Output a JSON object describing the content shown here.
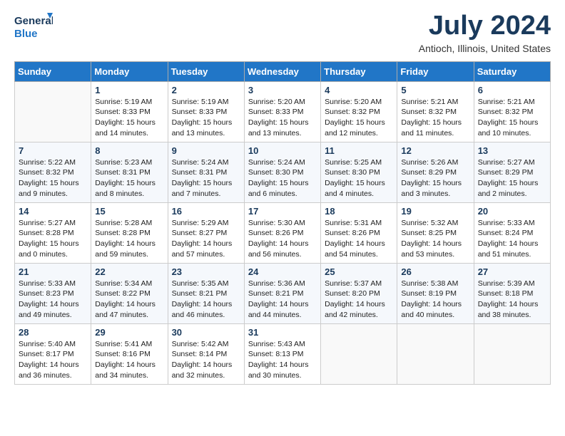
{
  "logo": {
    "line1": "General",
    "line2": "Blue"
  },
  "title": "July 2024",
  "location": "Antioch, Illinois, United States",
  "weekdays": [
    "Sunday",
    "Monday",
    "Tuesday",
    "Wednesday",
    "Thursday",
    "Friday",
    "Saturday"
  ],
  "weeks": [
    [
      {
        "day": "",
        "sunrise": "",
        "sunset": "",
        "daylight": ""
      },
      {
        "day": "1",
        "sunrise": "Sunrise: 5:19 AM",
        "sunset": "Sunset: 8:33 PM",
        "daylight": "Daylight: 15 hours and 14 minutes."
      },
      {
        "day": "2",
        "sunrise": "Sunrise: 5:19 AM",
        "sunset": "Sunset: 8:33 PM",
        "daylight": "Daylight: 15 hours and 13 minutes."
      },
      {
        "day": "3",
        "sunrise": "Sunrise: 5:20 AM",
        "sunset": "Sunset: 8:33 PM",
        "daylight": "Daylight: 15 hours and 13 minutes."
      },
      {
        "day": "4",
        "sunrise": "Sunrise: 5:20 AM",
        "sunset": "Sunset: 8:32 PM",
        "daylight": "Daylight: 15 hours and 12 minutes."
      },
      {
        "day": "5",
        "sunrise": "Sunrise: 5:21 AM",
        "sunset": "Sunset: 8:32 PM",
        "daylight": "Daylight: 15 hours and 11 minutes."
      },
      {
        "day": "6",
        "sunrise": "Sunrise: 5:21 AM",
        "sunset": "Sunset: 8:32 PM",
        "daylight": "Daylight: 15 hours and 10 minutes."
      }
    ],
    [
      {
        "day": "7",
        "sunrise": "Sunrise: 5:22 AM",
        "sunset": "Sunset: 8:32 PM",
        "daylight": "Daylight: 15 hours and 9 minutes."
      },
      {
        "day": "8",
        "sunrise": "Sunrise: 5:23 AM",
        "sunset": "Sunset: 8:31 PM",
        "daylight": "Daylight: 15 hours and 8 minutes."
      },
      {
        "day": "9",
        "sunrise": "Sunrise: 5:24 AM",
        "sunset": "Sunset: 8:31 PM",
        "daylight": "Daylight: 15 hours and 7 minutes."
      },
      {
        "day": "10",
        "sunrise": "Sunrise: 5:24 AM",
        "sunset": "Sunset: 8:30 PM",
        "daylight": "Daylight: 15 hours and 6 minutes."
      },
      {
        "day": "11",
        "sunrise": "Sunrise: 5:25 AM",
        "sunset": "Sunset: 8:30 PM",
        "daylight": "Daylight: 15 hours and 4 minutes."
      },
      {
        "day": "12",
        "sunrise": "Sunrise: 5:26 AM",
        "sunset": "Sunset: 8:29 PM",
        "daylight": "Daylight: 15 hours and 3 minutes."
      },
      {
        "day": "13",
        "sunrise": "Sunrise: 5:27 AM",
        "sunset": "Sunset: 8:29 PM",
        "daylight": "Daylight: 15 hours and 2 minutes."
      }
    ],
    [
      {
        "day": "14",
        "sunrise": "Sunrise: 5:27 AM",
        "sunset": "Sunset: 8:28 PM",
        "daylight": "Daylight: 15 hours and 0 minutes."
      },
      {
        "day": "15",
        "sunrise": "Sunrise: 5:28 AM",
        "sunset": "Sunset: 8:28 PM",
        "daylight": "Daylight: 14 hours and 59 minutes."
      },
      {
        "day": "16",
        "sunrise": "Sunrise: 5:29 AM",
        "sunset": "Sunset: 8:27 PM",
        "daylight": "Daylight: 14 hours and 57 minutes."
      },
      {
        "day": "17",
        "sunrise": "Sunrise: 5:30 AM",
        "sunset": "Sunset: 8:26 PM",
        "daylight": "Daylight: 14 hours and 56 minutes."
      },
      {
        "day": "18",
        "sunrise": "Sunrise: 5:31 AM",
        "sunset": "Sunset: 8:26 PM",
        "daylight": "Daylight: 14 hours and 54 minutes."
      },
      {
        "day": "19",
        "sunrise": "Sunrise: 5:32 AM",
        "sunset": "Sunset: 8:25 PM",
        "daylight": "Daylight: 14 hours and 53 minutes."
      },
      {
        "day": "20",
        "sunrise": "Sunrise: 5:33 AM",
        "sunset": "Sunset: 8:24 PM",
        "daylight": "Daylight: 14 hours and 51 minutes."
      }
    ],
    [
      {
        "day": "21",
        "sunrise": "Sunrise: 5:33 AM",
        "sunset": "Sunset: 8:23 PM",
        "daylight": "Daylight: 14 hours and 49 minutes."
      },
      {
        "day": "22",
        "sunrise": "Sunrise: 5:34 AM",
        "sunset": "Sunset: 8:22 PM",
        "daylight": "Daylight: 14 hours and 47 minutes."
      },
      {
        "day": "23",
        "sunrise": "Sunrise: 5:35 AM",
        "sunset": "Sunset: 8:21 PM",
        "daylight": "Daylight: 14 hours and 46 minutes."
      },
      {
        "day": "24",
        "sunrise": "Sunrise: 5:36 AM",
        "sunset": "Sunset: 8:21 PM",
        "daylight": "Daylight: 14 hours and 44 minutes."
      },
      {
        "day": "25",
        "sunrise": "Sunrise: 5:37 AM",
        "sunset": "Sunset: 8:20 PM",
        "daylight": "Daylight: 14 hours and 42 minutes."
      },
      {
        "day": "26",
        "sunrise": "Sunrise: 5:38 AM",
        "sunset": "Sunset: 8:19 PM",
        "daylight": "Daylight: 14 hours and 40 minutes."
      },
      {
        "day": "27",
        "sunrise": "Sunrise: 5:39 AM",
        "sunset": "Sunset: 8:18 PM",
        "daylight": "Daylight: 14 hours and 38 minutes."
      }
    ],
    [
      {
        "day": "28",
        "sunrise": "Sunrise: 5:40 AM",
        "sunset": "Sunset: 8:17 PM",
        "daylight": "Daylight: 14 hours and 36 minutes."
      },
      {
        "day": "29",
        "sunrise": "Sunrise: 5:41 AM",
        "sunset": "Sunset: 8:16 PM",
        "daylight": "Daylight: 14 hours and 34 minutes."
      },
      {
        "day": "30",
        "sunrise": "Sunrise: 5:42 AM",
        "sunset": "Sunset: 8:14 PM",
        "daylight": "Daylight: 14 hours and 32 minutes."
      },
      {
        "day": "31",
        "sunrise": "Sunrise: 5:43 AM",
        "sunset": "Sunset: 8:13 PM",
        "daylight": "Daylight: 14 hours and 30 minutes."
      },
      {
        "day": "",
        "sunrise": "",
        "sunset": "",
        "daylight": ""
      },
      {
        "day": "",
        "sunrise": "",
        "sunset": "",
        "daylight": ""
      },
      {
        "day": "",
        "sunrise": "",
        "sunset": "",
        "daylight": ""
      }
    ]
  ]
}
